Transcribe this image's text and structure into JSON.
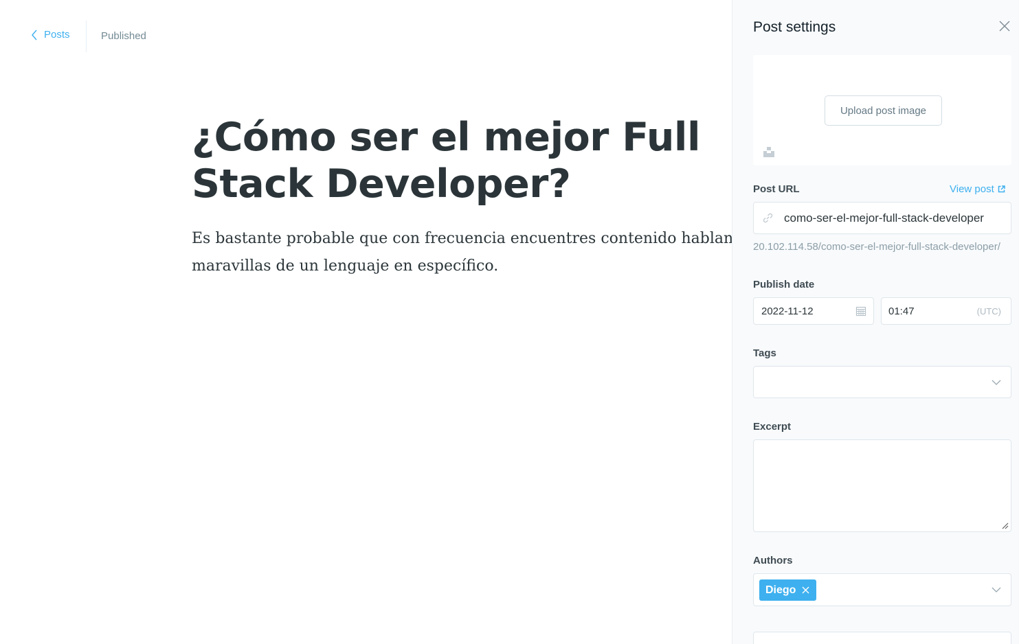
{
  "editor": {
    "back_label": "Posts",
    "status": "Published",
    "title": "¿Cómo ser el mejor Full Stack Developer?",
    "body": "Es bastante probable que con frecuencia encuentres contenido hablando de las maravillas de un lenguaje en específico."
  },
  "settings": {
    "title": "Post settings",
    "upload_label": "Upload post image",
    "post_url_label": "Post URL",
    "view_post_label": "View post",
    "url_value": "como-ser-el-mejor-full-stack-developer",
    "url_hint": "20.102.114.58/como-ser-el-mejor-full-stack-developer/",
    "publish_date_label": "Publish date",
    "date_value": "2022-11-12",
    "time_value": "01:47",
    "timezone": "(UTC)",
    "tags_label": "Tags",
    "excerpt_label": "Excerpt",
    "authors_label": "Authors",
    "authors": [
      "Diego"
    ]
  },
  "colors": {
    "accent": "#3eb0ef",
    "panel_bg": "#f8fafc",
    "text": "#2b3539"
  }
}
